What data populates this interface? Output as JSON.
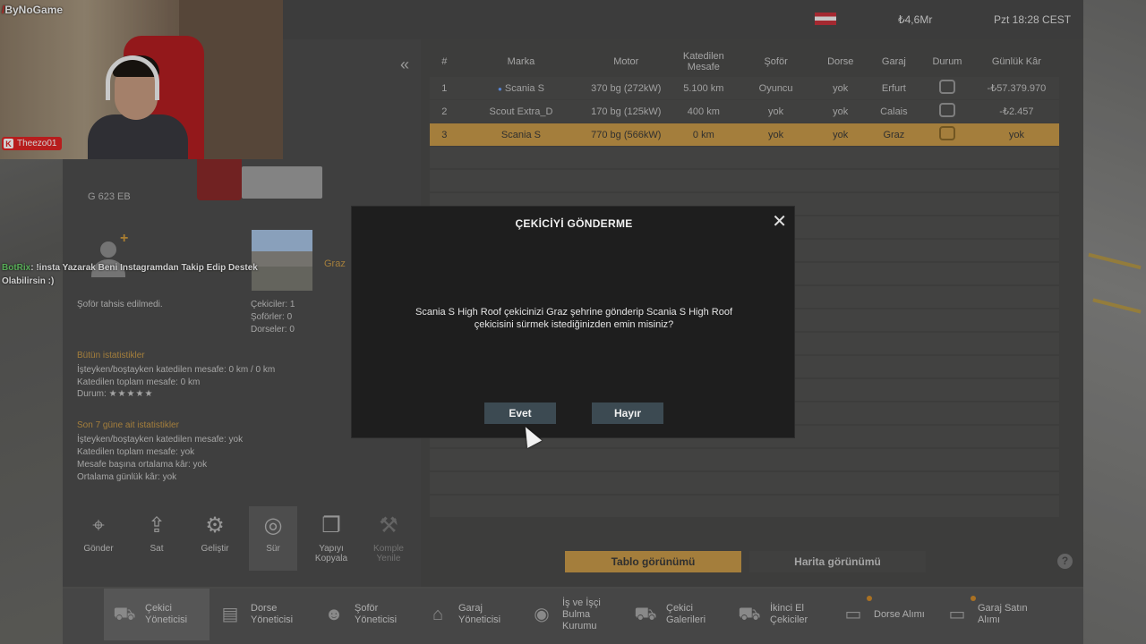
{
  "stream": {
    "brand": "ByNoGame",
    "kick_user": "Theezo01",
    "chat": {
      "bot_name": "BotRix",
      "message": ": !insta Yazarak Beni Instagramdan Takip Edip Destek Olabilirsin :)"
    }
  },
  "topbar": {
    "money": "₺4,6Mr",
    "clock": "Pzt 18:28 CEST"
  },
  "truck": {
    "plate": "G 623 EB",
    "driver_status": "Şoför tahsis edilmedi.",
    "garage_city": "Graz",
    "counts": {
      "trucks": "Çekiciler: 1",
      "drivers": "Şoförler: 0",
      "trailers": "Dorseler: 0"
    },
    "all_stats": {
      "title": "Bütün istatistikler",
      "loaded_empty": "İşteyken/boştayken katedilen mesafe: 0 km / 0 km",
      "total": "Katedilen toplam mesafe: 0 km",
      "status_label": "Durum:",
      "stars": "★★★★★"
    },
    "week_stats": {
      "title": "Son 7 güne ait istatistikler",
      "loaded_empty": "İşteyken/boştayken katedilen mesafe: yok",
      "total": "Katedilen toplam mesafe: yok",
      "profit_per_distance": "Mesafe başına ortalama kâr: yok",
      "daily_profit": "Ortalama günlük kâr: yok"
    }
  },
  "actions": [
    {
      "label": "Gönder",
      "icon": "send-location-icon"
    },
    {
      "label": "Sat",
      "icon": "sell-hand-icon"
    },
    {
      "label": "Geliştir",
      "icon": "upgrade-gear-icon"
    },
    {
      "label": "Sür",
      "icon": "steering-wheel-icon"
    },
    {
      "label": "Yapıyı Kopyala",
      "icon": "copy-config-icon"
    },
    {
      "label": "Komple Yenile",
      "icon": "repair-icon"
    }
  ],
  "table": {
    "headers": [
      "#",
      "Marka",
      "Motor",
      "Katedilen Mesafe",
      "Şoför",
      "Dorse",
      "Garaj",
      "Durum",
      "Günlük Kâr"
    ],
    "rows": [
      [
        "1",
        "Scania S",
        "370 bg (272kW)",
        "5.100 km",
        "Oyuncu",
        "yok",
        "Erfurt",
        "",
        "-₺57.379.970"
      ],
      [
        "2",
        "Scout Extra_D",
        "170 bg (125kW)",
        "400 km",
        "yok",
        "yok",
        "Calais",
        "",
        "-₺2.457"
      ],
      [
        "3",
        "Scania S",
        "770 bg (566kW)",
        "0 km",
        "yok",
        "yok",
        "Graz",
        "",
        "yok"
      ]
    ]
  },
  "views": {
    "table": "Tablo görünümü",
    "map": "Harita görünümü",
    "help": "?"
  },
  "menu": [
    {
      "label": "Çekici Yöneticisi",
      "icon": "truck-manager-icon"
    },
    {
      "label": "Dorse Yöneticisi",
      "icon": "trailer-manager-icon"
    },
    {
      "label": "Şoför Yöneticisi",
      "icon": "driver-manager-icon"
    },
    {
      "label": "Garaj Yöneticisi",
      "icon": "garage-manager-icon"
    },
    {
      "label": "İş ve İşçi Bulma Kurumu",
      "icon": "recruitment-icon"
    },
    {
      "label": "Çekici Galerileri",
      "icon": "truck-dealer-icon"
    },
    {
      "label": "İkinci El Çekiciler",
      "icon": "used-trucks-icon"
    },
    {
      "label": "Dorse Alımı",
      "icon": "trailer-purchase-icon"
    },
    {
      "label": "Garaj Satın Alımı",
      "icon": "garage-purchase-icon"
    }
  ],
  "dialog": {
    "title": "ÇEKİCİYİ GÖNDERME",
    "message": "Scania S High Roof çekicinizi Graz şehrine gönderip Scania S High Roof çekicisini sürmek istediğinizden emin misiniz?",
    "yes": "Evet",
    "no": "Hayır",
    "close": "✕"
  }
}
